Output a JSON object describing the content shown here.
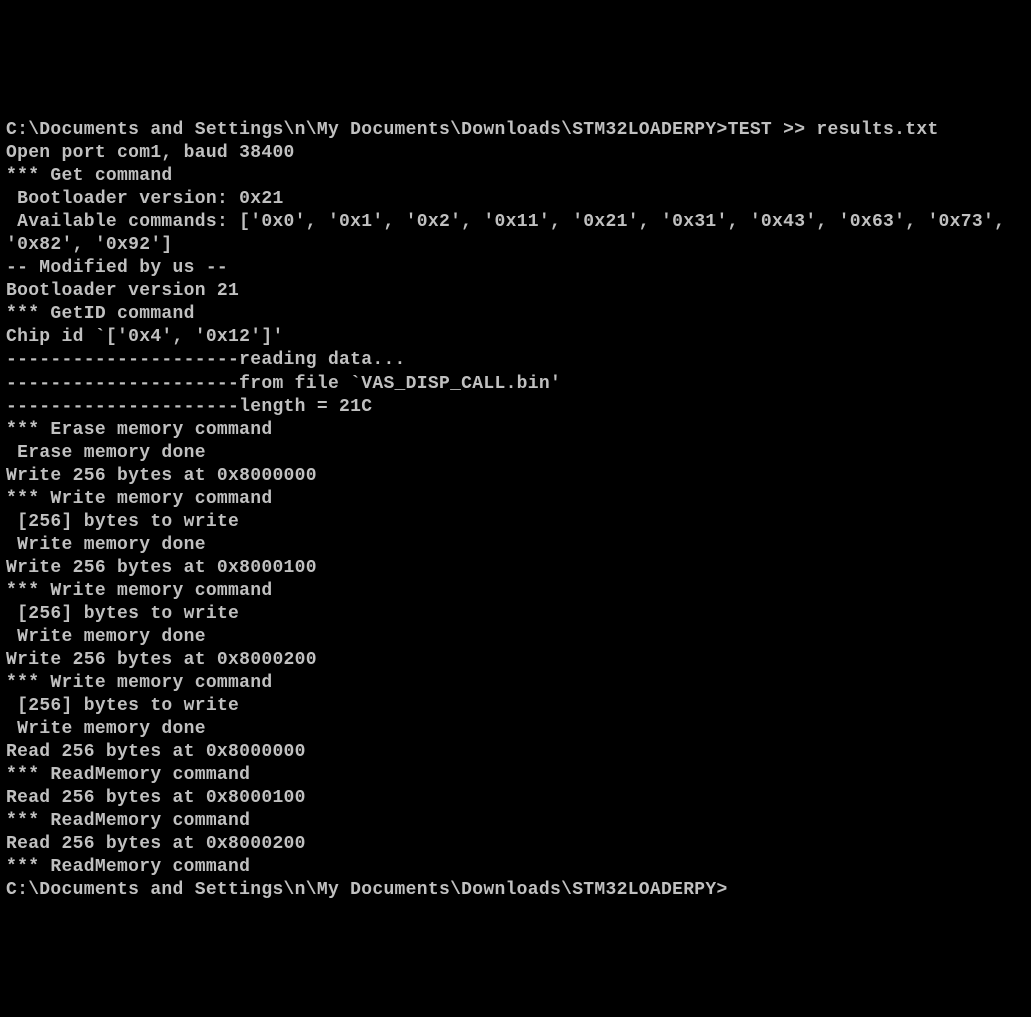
{
  "terminal": {
    "prompt_line": "C:\\Documents and Settings\\n\\My Documents\\Downloads\\STM32LOADERPY>TEST >> results.txt",
    "lines": [
      "Open port com1, baud 38400",
      "*** Get command",
      " Bootloader version: 0x21",
      " Available commands: ['0x0', '0x1', '0x2', '0x11', '0x21', '0x31', '0x43', '0x63', '0x73', '0x82', '0x92']",
      "",
      "-- Modified by us --",
      "Bootloader version 21",
      "*** GetID command",
      "Chip id `['0x4', '0x12']'",
      "---------------------reading data...",
      "---------------------from file `VAS_DISP_CALL.bin'",
      "---------------------length = 21C",
      "*** Erase memory command",
      " Erase memory done",
      "Write 256 bytes at 0x8000000",
      "*** Write memory command",
      " [256] bytes to write",
      " Write memory done",
      "Write 256 bytes at 0x8000100",
      "*** Write memory command",
      " [256] bytes to write",
      " Write memory done",
      "Write 256 bytes at 0x8000200",
      "*** Write memory command",
      " [256] bytes to write",
      " Write memory done",
      "Read 256 bytes at 0x8000000",
      "*** ReadMemory command",
      "Read 256 bytes at 0x8000100",
      "*** ReadMemory command",
      "Read 256 bytes at 0x8000200",
      "*** ReadMemory command",
      ""
    ],
    "final_prompt": "C:\\Documents and Settings\\n\\My Documents\\Downloads\\STM32LOADERPY>"
  }
}
